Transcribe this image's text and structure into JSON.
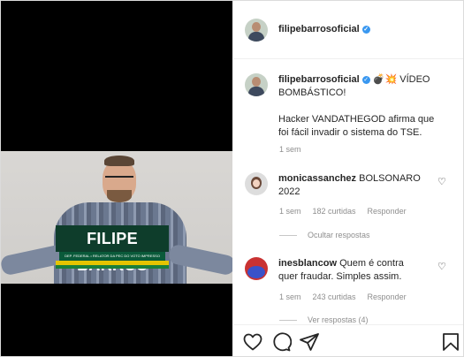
{
  "post": {
    "author": "filipebarrosoficial",
    "nameplate": {
      "name": "FILIPE BARROS",
      "subtitle": "DEP. FEDERAL • RELATOR DA PEC DO VOTO IMPRESSO"
    }
  },
  "header": {
    "username": "filipebarrosoficial",
    "verified_glyph": "✓"
  },
  "caption": {
    "username": "filipebarrosoficial",
    "emojis": "💣💥",
    "line1": "VÍDEO",
    "line2": "BOMBÁSTICO!",
    "body_line1": "Hacker VANDATHEGOD afirma que",
    "body_line2": "foi fácil invadir o sistema do TSE.",
    "time": "1 sem"
  },
  "comments": [
    {
      "username": "monicassanchez",
      "text_line1": "BOLSONARO",
      "text_line2": "2022",
      "time": "1 sem",
      "likes": "182 curtidas",
      "reply": "Responder",
      "hide_replies": "Ocultar respostas"
    },
    {
      "username": "inesblancow",
      "text_line1": "Quem é contra",
      "text_line2": "quer fraudar. Simples assim.",
      "time": "1 sem",
      "likes": "243 curtidas",
      "reply": "Responder",
      "view_replies": "Ver respostas (4)"
    }
  ],
  "icons": {
    "heart": "♡",
    "like": "like-heart-icon",
    "comment": "comment-bubble-icon",
    "share": "share-paper-plane-icon",
    "save": "save-bookmark-icon"
  },
  "colors": {
    "verified": "#3897f0",
    "secondary_text": "#8e8e8e"
  }
}
